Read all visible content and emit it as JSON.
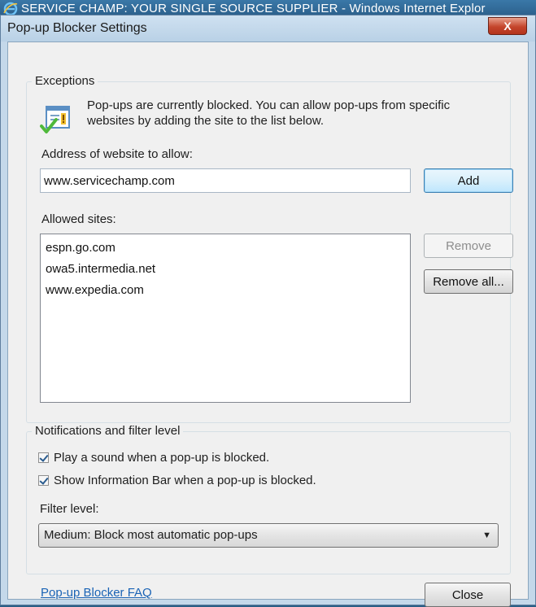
{
  "browser": {
    "title": "SERVICE CHAMP: YOUR SINGLE SOURCE SUPPLIER - Windows Internet Explor"
  },
  "dialog": {
    "title": "Pop-up Blocker Settings",
    "close_glyph": "X",
    "exceptions": {
      "legend": "Exceptions",
      "info_text": "Pop-ups are currently blocked.  You can allow pop-ups from specific websites by adding the site to the list below.",
      "address_label": "Address of website to allow:",
      "address_value": "www.servicechamp.com",
      "add_button": "Add",
      "allowed_label": "Allowed sites:",
      "allowed_sites": [
        "espn.go.com",
        "owa5.intermedia.net",
        "www.expedia.com"
      ],
      "remove_button": "Remove",
      "remove_all_button": "Remove all..."
    },
    "notifications": {
      "legend": "Notifications and filter level",
      "play_sound": {
        "label": "Play a sound when a pop-up is blocked.",
        "checked": true
      },
      "show_info_bar": {
        "label": "Show Information Bar when a pop-up is blocked.",
        "checked": true
      },
      "filter_label": "Filter level:",
      "filter_value": "Medium: Block most automatic pop-ups"
    },
    "faq_link": "Pop-up Blocker FAQ",
    "close_button": "Close"
  },
  "colors": {
    "link": "#1a63b5",
    "dialog_frame": "#c4d8ea",
    "client_bg": "#f0f0f0"
  },
  "icons": [
    "ie-logo-icon",
    "close-icon",
    "info-shield-icon",
    "dropdown-arrow-icon"
  ]
}
